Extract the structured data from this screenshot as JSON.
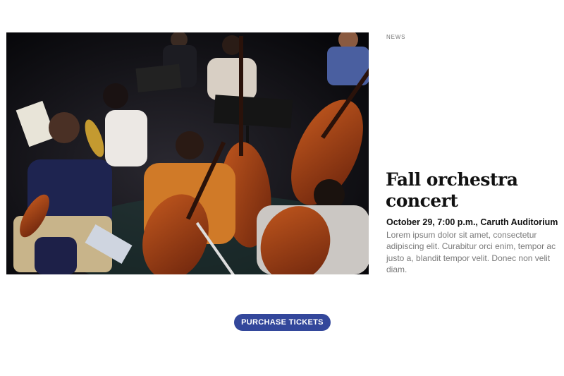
{
  "article": {
    "category": "NEWS",
    "title": "Fall orchestra concert",
    "meta": "October 29, 7:00 p.m., Caruth Auditorium",
    "body": "Lorem ipsum dolor sit amet, consectetur adipiscing elit. Curabitur orci enim, tempor ac justo a, blandit tempor velit. Donec non velit diam."
  },
  "cta": {
    "label": "PURCHASE TICKETS"
  },
  "colors": {
    "button": "#33479b",
    "category_text": "#777777",
    "body_text": "#7a7a7a"
  }
}
